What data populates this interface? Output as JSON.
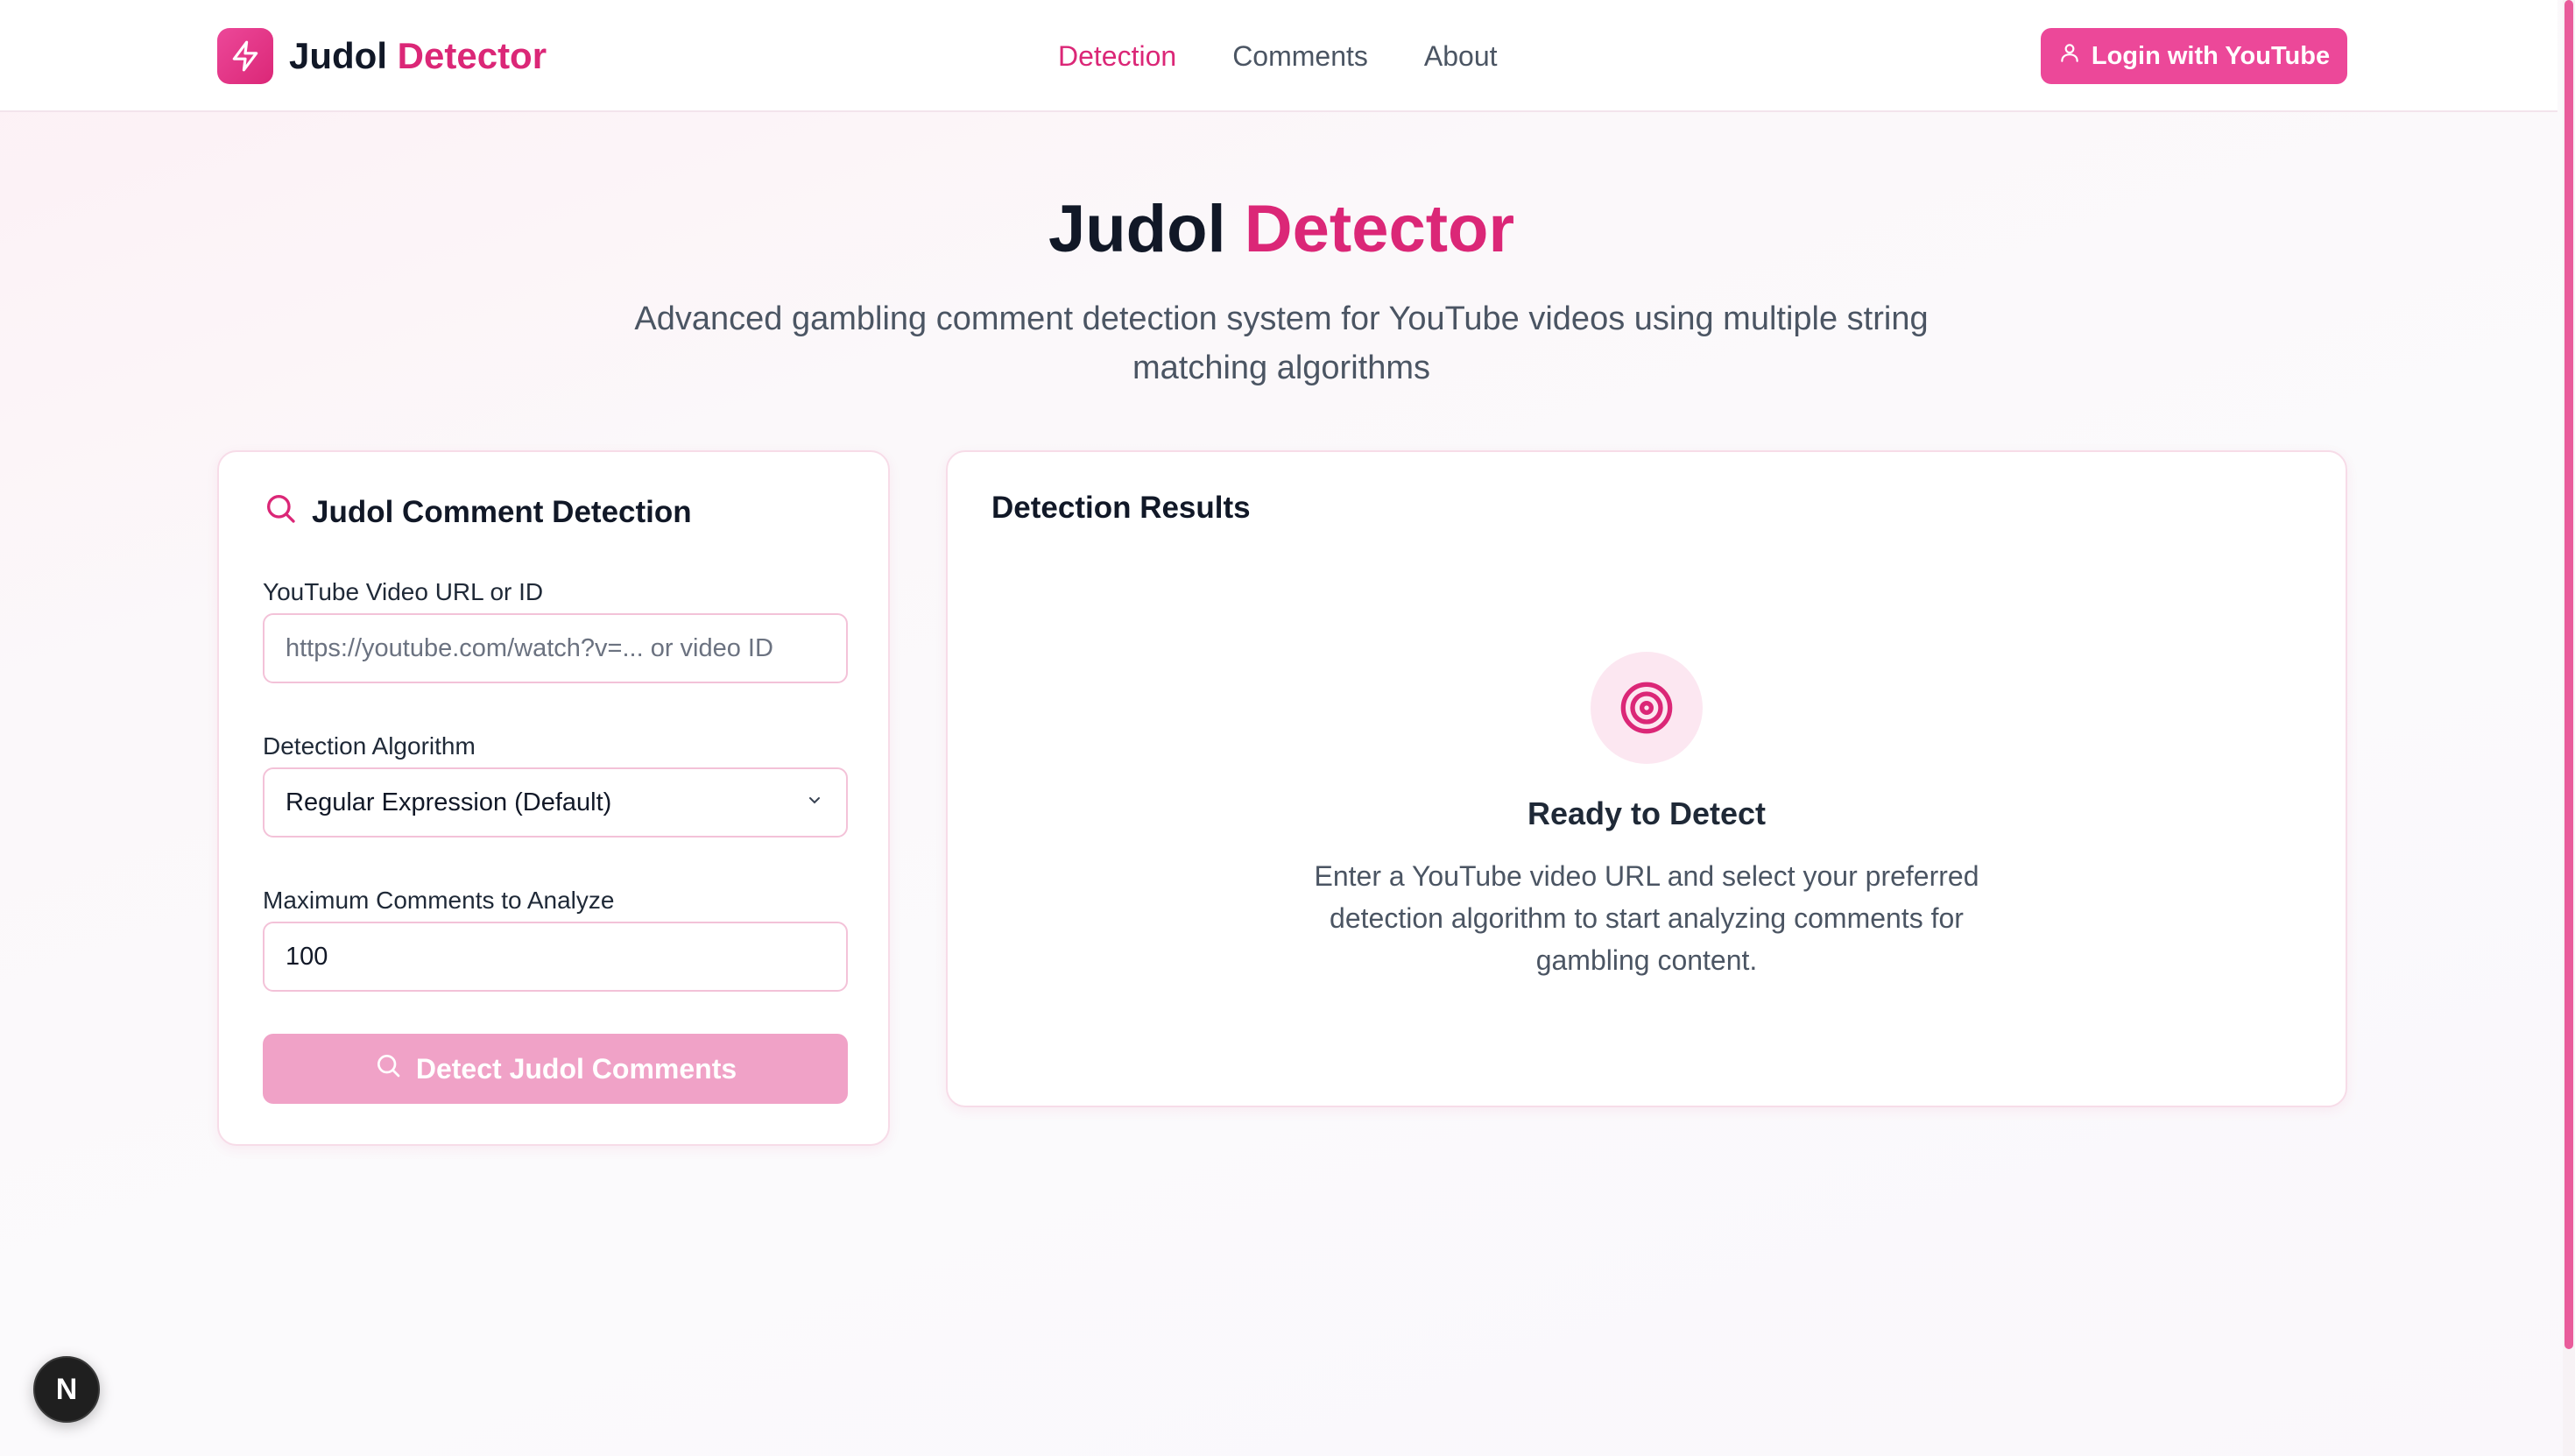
{
  "brand": {
    "name": "Judol",
    "accent": "Detector",
    "icon": "lightning-bolt-icon"
  },
  "nav": {
    "items": [
      {
        "label": "Detection",
        "active": true
      },
      {
        "label": "Comments",
        "active": false
      },
      {
        "label": "About",
        "active": false
      }
    ]
  },
  "login": {
    "label": "Login with YouTube",
    "icon": "user-icon"
  },
  "hero": {
    "title": "Judol",
    "title_accent": "Detector",
    "subtitle": "Advanced gambling comment detection system for YouTube videos using multiple string matching algorithms"
  },
  "detection_form": {
    "title": "Judol Comment Detection",
    "icon": "search-icon",
    "url_label": "YouTube Video URL or ID",
    "url_placeholder": "https://youtube.com/watch?v=... or video ID",
    "url_value": "",
    "algorithm_label": "Detection Algorithm",
    "algorithm_selected": "Regular Expression (Default)",
    "max_label": "Maximum Comments to Analyze",
    "max_value": "100",
    "submit_label": "Detect Judol Comments"
  },
  "results": {
    "title": "Detection Results",
    "icon": "target-icon",
    "empty_title": "Ready to Detect",
    "empty_desc": "Enter a YouTube video URL and select your preferred detection algorithm to start analyzing comments for gambling content."
  },
  "dev_badge": {
    "label": "N"
  },
  "colors": {
    "accent": "#db2777",
    "button": "#ec4899",
    "button_disabled": "#f0a2c7"
  }
}
